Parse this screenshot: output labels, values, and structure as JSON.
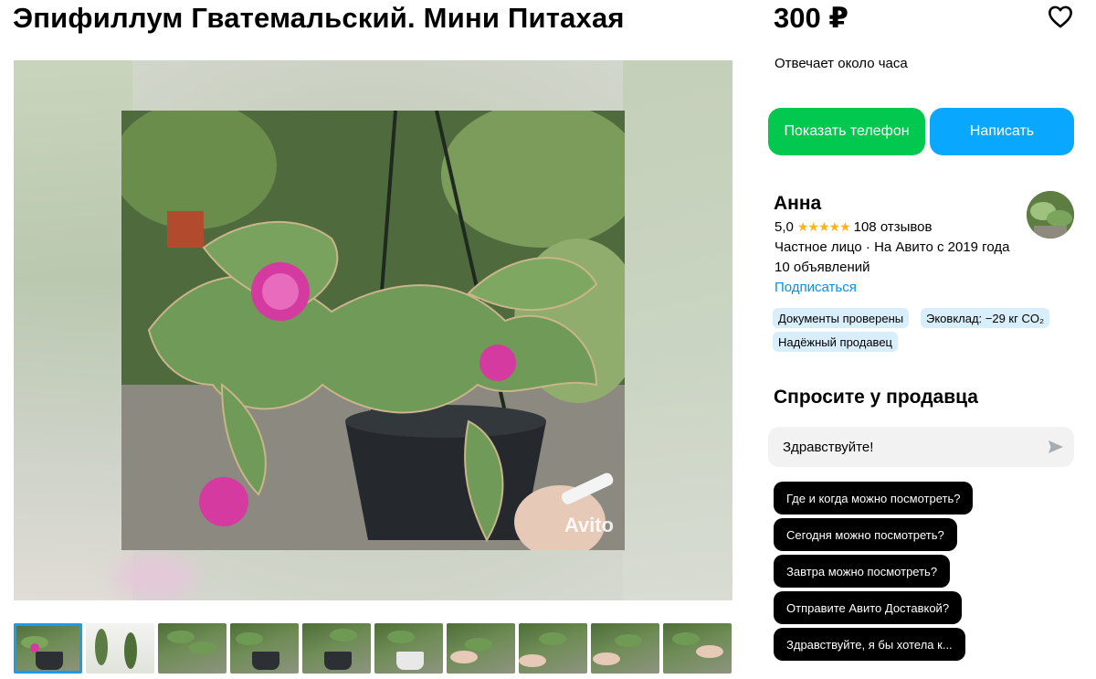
{
  "listing": {
    "title": "Эпифиллум Гватемальский. Мини Питахая",
    "price": "300 ₽",
    "watermark": "Avito"
  },
  "seller_panel": {
    "reply_time": "Отвечает около часа",
    "show_phone_label": "Показать телефон",
    "write_label": "Написать",
    "name": "Анна",
    "rating_value": "5,0",
    "rating_stars": "★★★★★",
    "reviews": "108 отзывов",
    "status": "Частное лицо · На Авито с 2019 года",
    "listings_count": "10 объявлений",
    "subscribe_label": "Подписаться",
    "badges": [
      "Документы проверены",
      "Эковклад: −29 кг CO₂",
      "Надёжный продавец"
    ]
  },
  "ask_seller": {
    "title": "Спросите у продавца",
    "message_value": "Здравствуйте!",
    "quick_questions": [
      "Где и когда можно посмотреть?",
      "Сегодня можно посмотреть?",
      "Завтра можно посмотреть?",
      "Отправите Авито Доставкой?",
      "Здравствуйте, я бы хотела к..."
    ]
  },
  "icons": {
    "favorite": "heart-outline-icon",
    "send": "send-arrow-icon"
  },
  "colors": {
    "phone_button": "#03c850",
    "write_button": "#0aa7ff",
    "link": "#0a8ee0",
    "badge_bg": "#d9eefb",
    "star": "#ffb21e",
    "thumb_active": "#1a9bf0"
  },
  "thumbnails": {
    "count": 10,
    "active_index": 0
  }
}
